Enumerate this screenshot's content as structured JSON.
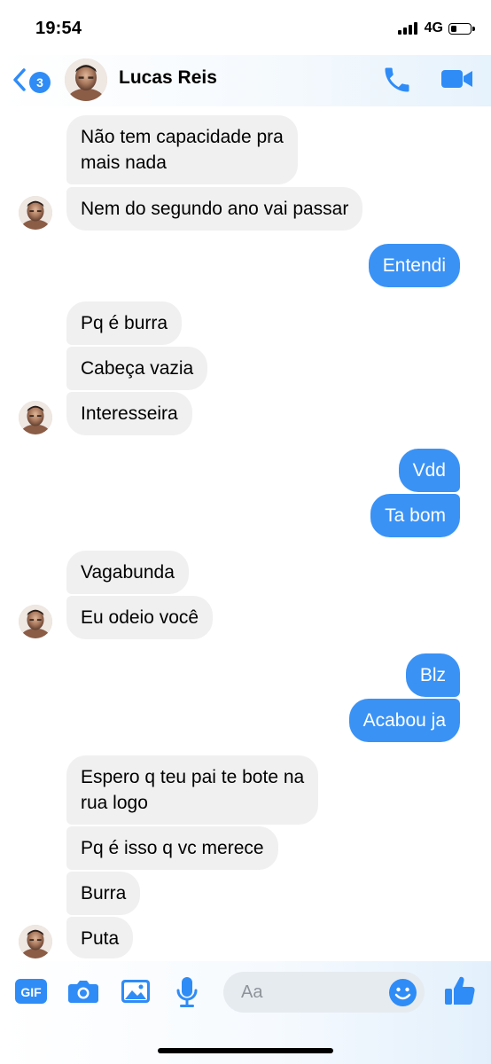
{
  "status": {
    "time": "19:54",
    "network": "4G"
  },
  "header": {
    "back_badge": "3",
    "contact_name": "Lucas Reis",
    "icons": {
      "back": "chevron-left-icon",
      "call": "phone-icon",
      "video": "video-camera-icon"
    },
    "accent": "#2f8cf6"
  },
  "messages": [
    {
      "from": "contact",
      "text_lines": [
        "Não tem capacidade pra",
        "mais nada"
      ]
    },
    {
      "from": "contact",
      "text": "Nem do segundo ano vai passar"
    },
    {
      "from": "me",
      "text": "Entendi"
    },
    {
      "from": "contact",
      "text": "Pq é burra"
    },
    {
      "from": "contact",
      "text": "Cabeça vazia"
    },
    {
      "from": "contact",
      "text": "Interesseira"
    },
    {
      "from": "me",
      "text": "Vdd"
    },
    {
      "from": "me",
      "text": "Ta bom"
    },
    {
      "from": "contact",
      "text": "Vagabunda"
    },
    {
      "from": "contact",
      "text": "Eu odeio você"
    },
    {
      "from": "me",
      "text": "Blz"
    },
    {
      "from": "me",
      "text": "Acabou ja"
    },
    {
      "from": "contact",
      "text_lines": [
        "Espero q teu pai te bote na",
        "rua logo"
      ]
    },
    {
      "from": "contact",
      "text": "Pq é isso q vc merece"
    },
    {
      "from": "contact",
      "text": "Burra"
    },
    {
      "from": "contact",
      "text": "Puta"
    }
  ],
  "composer": {
    "gif_label": "GIF",
    "placeholder": "Aa",
    "icons": [
      "gif-icon",
      "camera-icon",
      "image-icon",
      "microphone-icon",
      "emoji-icon",
      "thumbs-up-icon"
    ]
  },
  "colors": {
    "outgoing_bubble": "#3a92f5",
    "incoming_bubble": "#f0f0f0"
  }
}
